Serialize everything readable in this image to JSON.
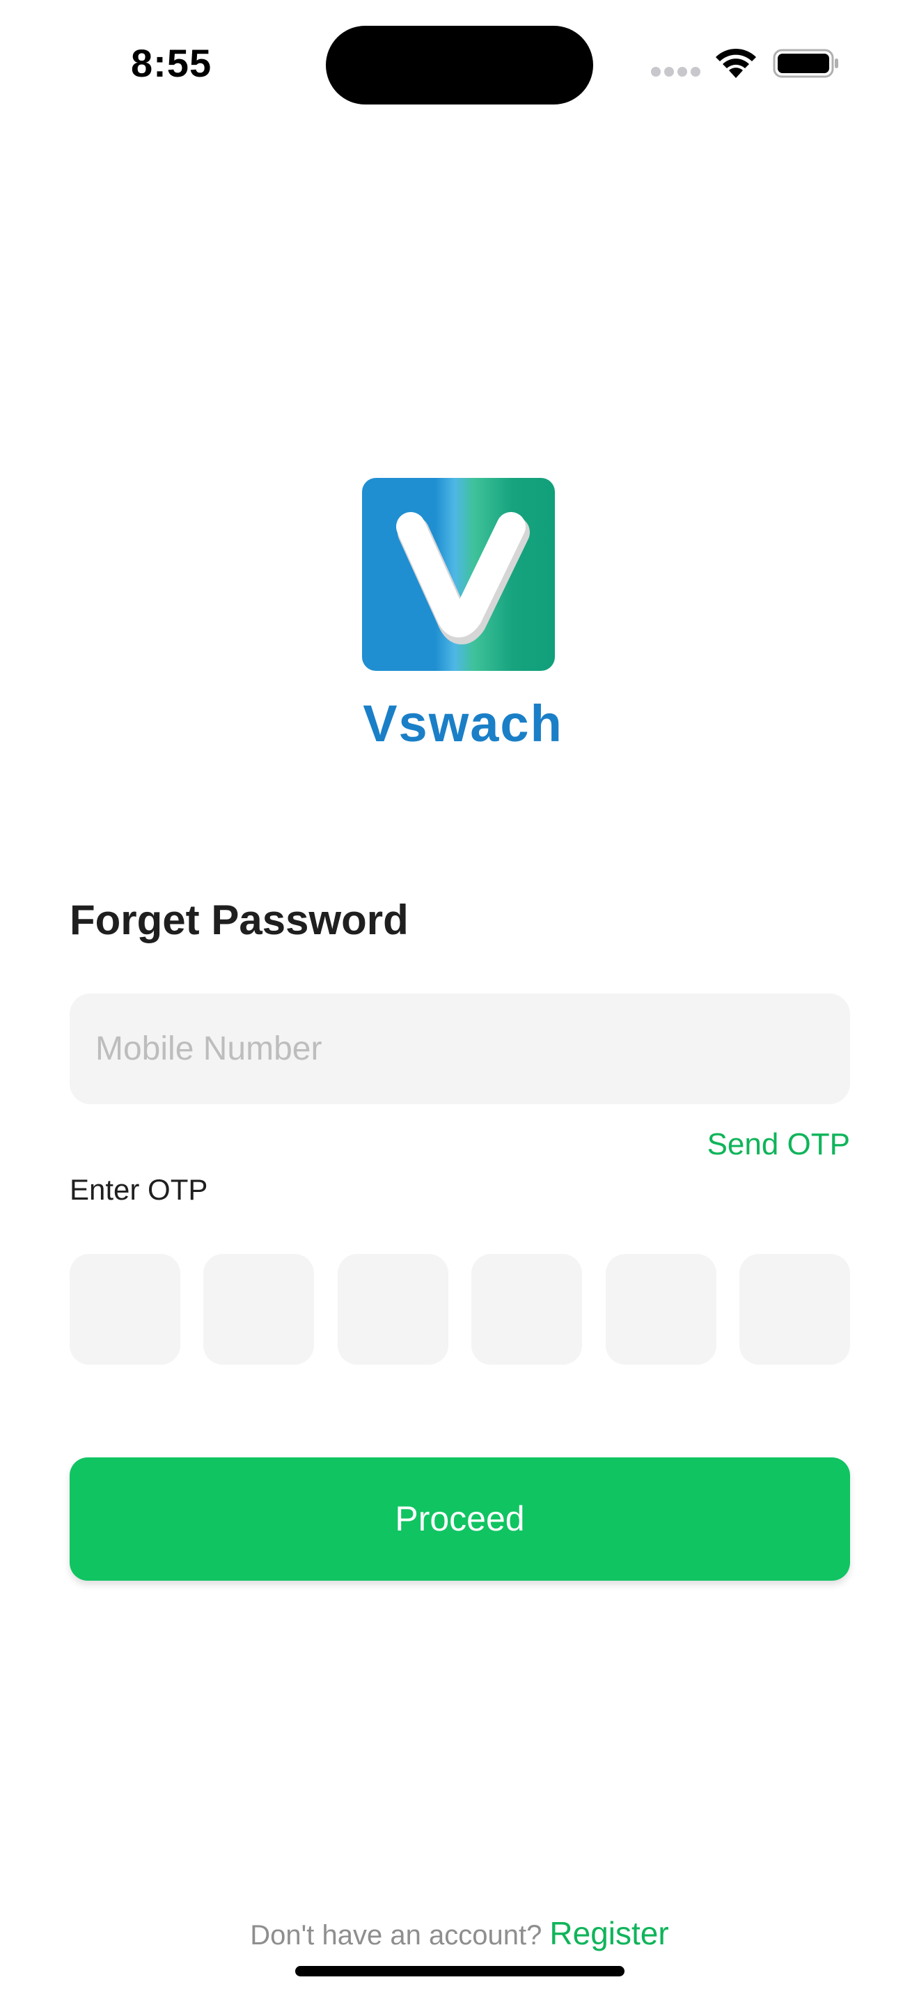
{
  "status_bar": {
    "time": "8:55",
    "icons": [
      "signal-icon",
      "wifi-icon",
      "battery-icon"
    ]
  },
  "brand": {
    "name": "Vswach",
    "logo_icon": "vswach-logo",
    "colors": {
      "blue": "#1f8fd1",
      "green": "#16a37e",
      "text": "#1a7fc7"
    }
  },
  "form": {
    "title": "Forget Password",
    "mobile_placeholder": "Mobile Number",
    "mobile_value": "",
    "send_otp_label": "Send OTP",
    "otp_label": "Enter OTP",
    "otp_digits": [
      "",
      "",
      "",
      "",
      "",
      ""
    ],
    "proceed_label": "Proceed",
    "accent_color": "#10c462"
  },
  "footer": {
    "prompt": "Don't have an account? ",
    "register_label": "Register"
  }
}
